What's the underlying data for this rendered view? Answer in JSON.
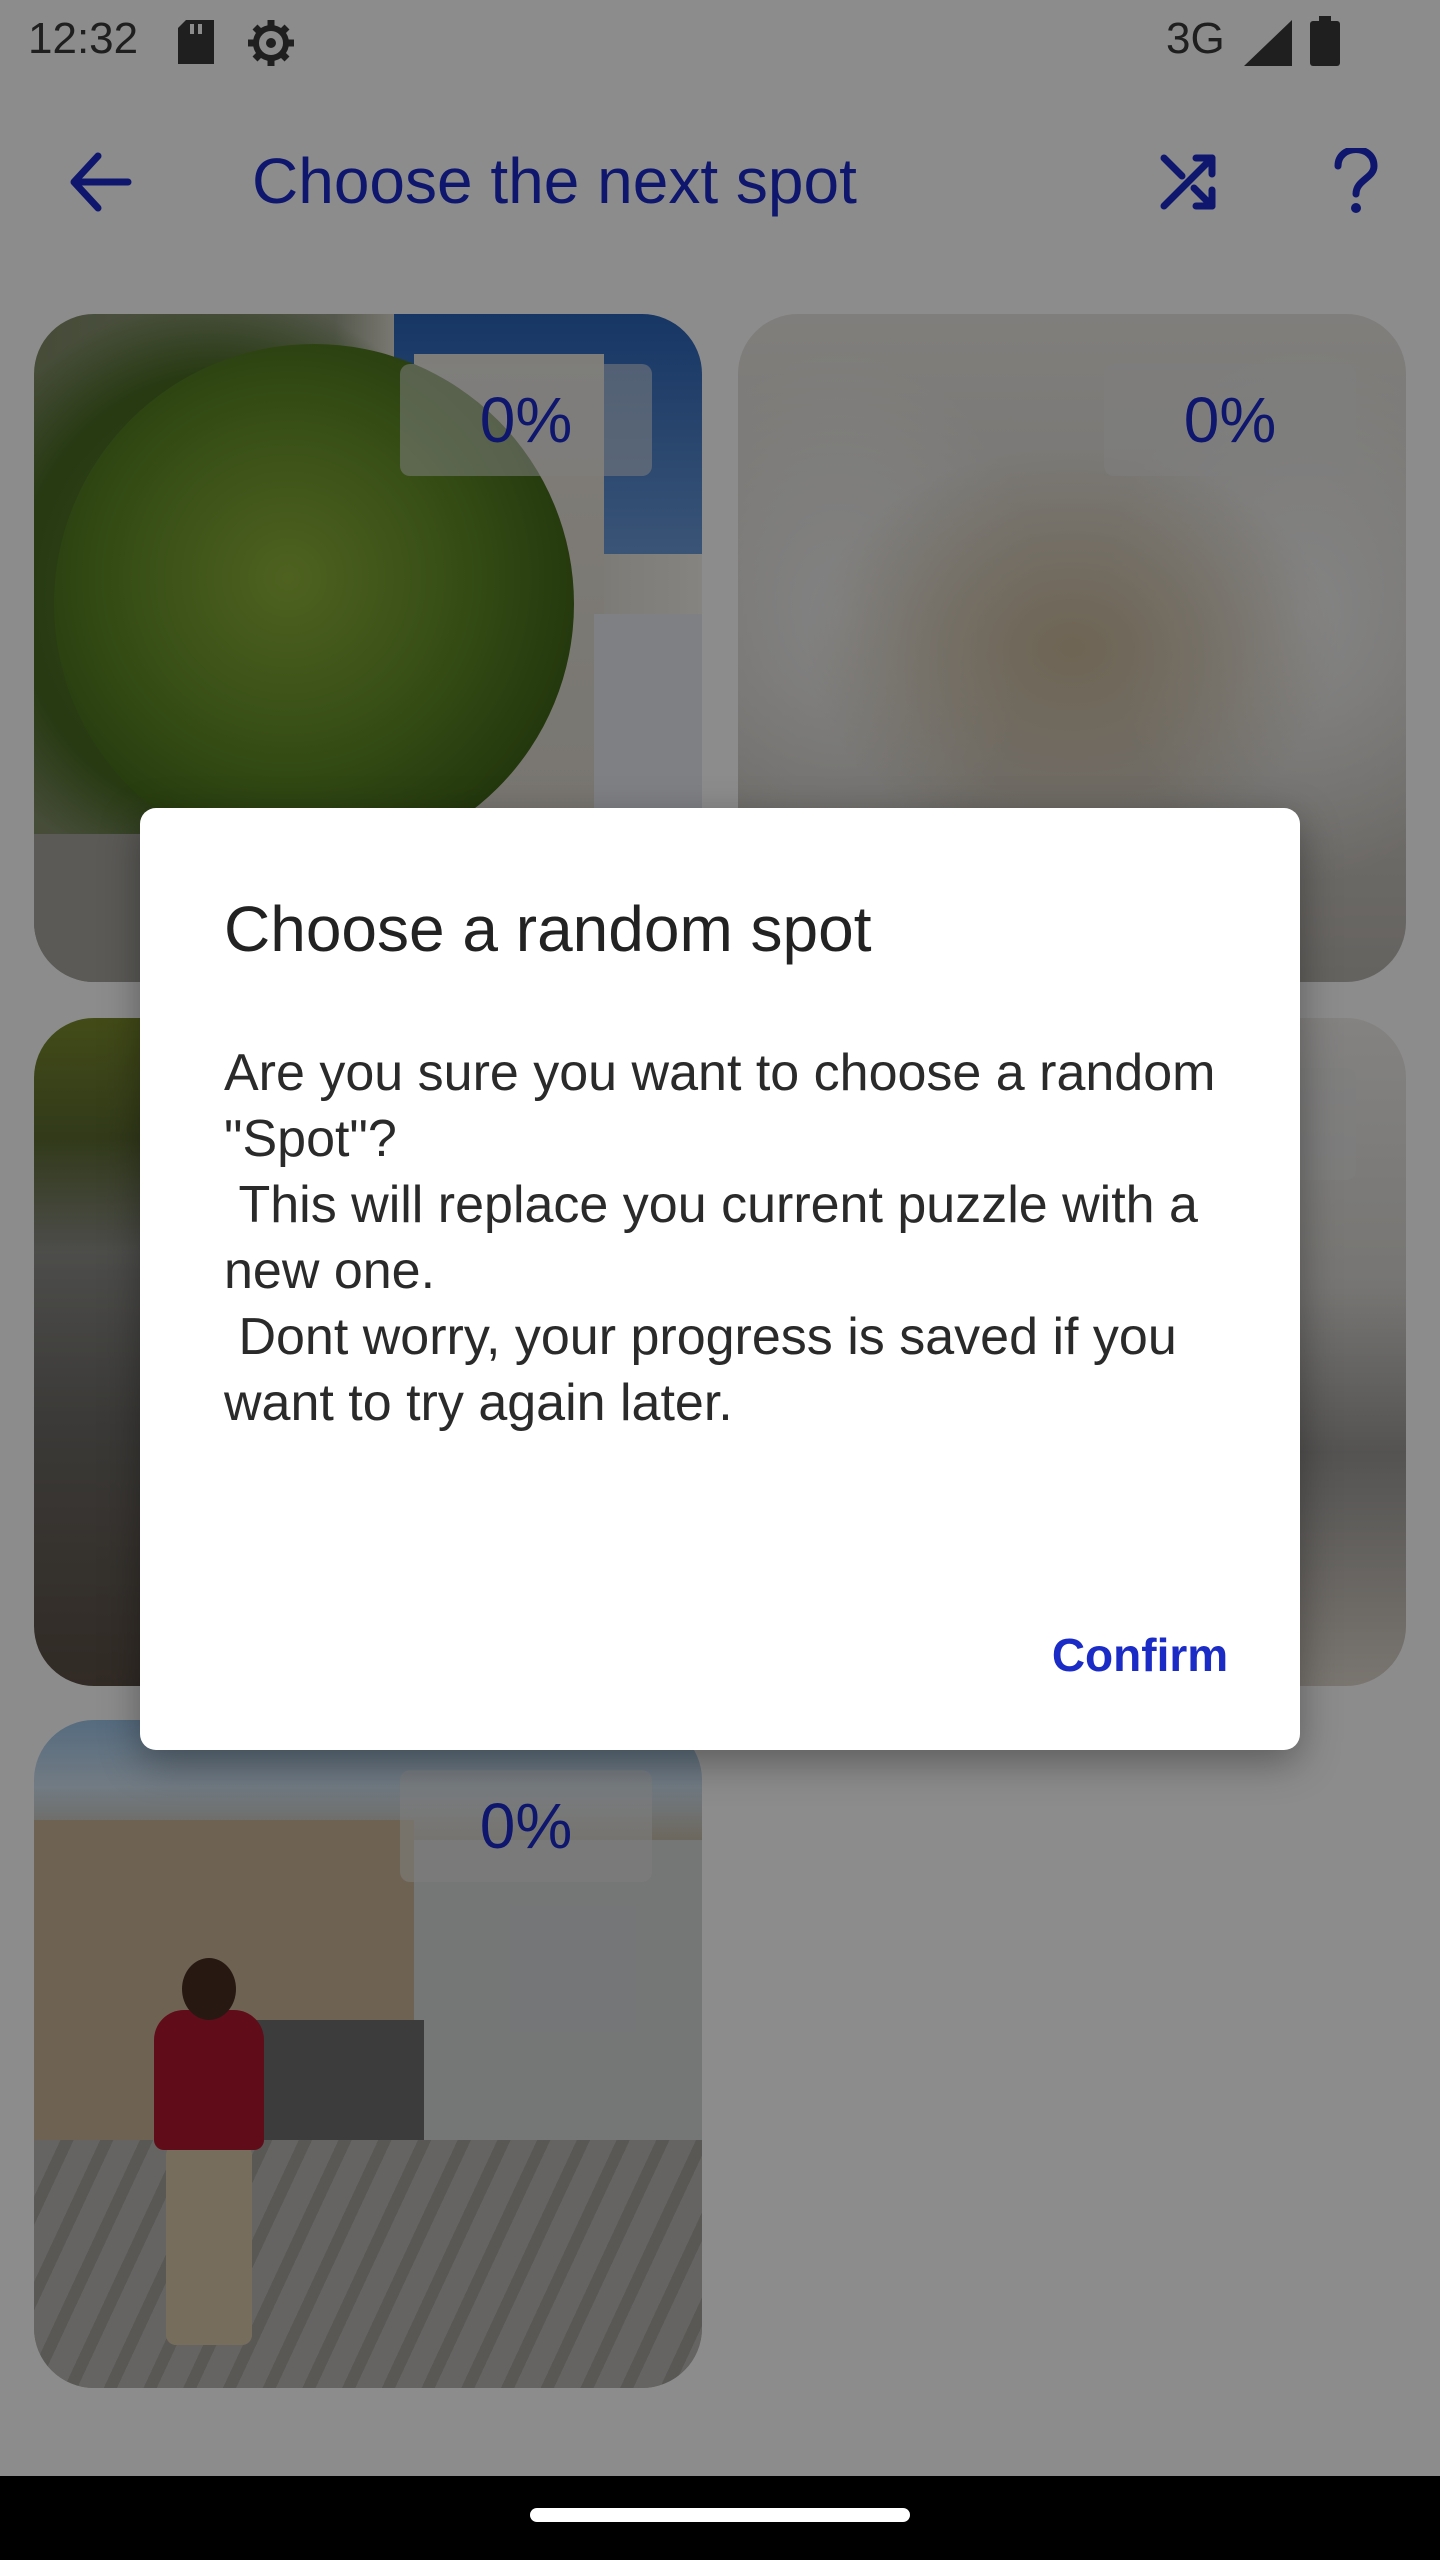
{
  "status_bar": {
    "time": "12:32",
    "network": "3G",
    "icons": [
      "sd-card-icon",
      "settings-icon",
      "signal-icon",
      "battery-icon"
    ]
  },
  "app_bar": {
    "title": "Choose the next spot",
    "icons": {
      "back": "arrow-left-icon",
      "shuffle": "shuffle-icon",
      "help": "question-mark-icon"
    }
  },
  "spots": [
    {
      "progress": "0%"
    },
    {
      "progress": "0%"
    },
    {
      "progress": "0%"
    }
  ],
  "dialog": {
    "title": "Choose a random spot",
    "body": "Are you sure you want to choose a random \"Spot\"?\n This will replace you current puzzle with a new one.\n Dont worry, your progress is saved if you want to try again later.",
    "confirm_label": "Confirm"
  },
  "colors": {
    "accent": "#1a2bc6",
    "scrim": "rgba(0,0,0,0.45)",
    "dialog_bg": "#ffffff"
  }
}
